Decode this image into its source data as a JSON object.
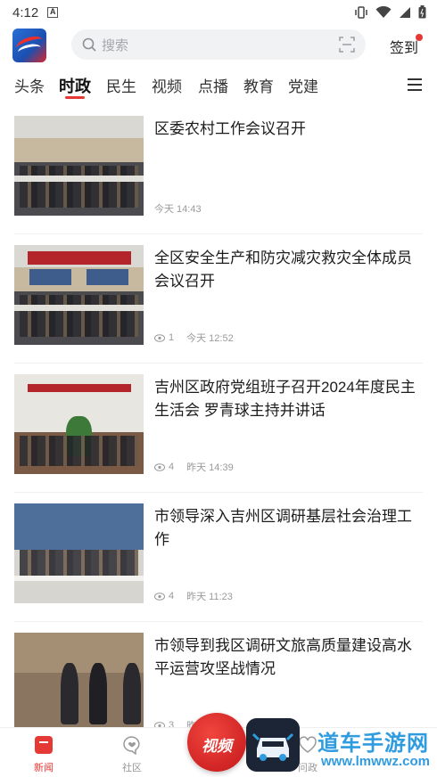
{
  "status_bar": {
    "time": "4:12",
    "notification_glyph": "A"
  },
  "header": {
    "search_placeholder": "搜索",
    "signin_label": "签到"
  },
  "tabs": [
    {
      "label": "头条",
      "active": false
    },
    {
      "label": "时政",
      "active": true
    },
    {
      "label": "民生",
      "active": false
    },
    {
      "label": "视频",
      "active": false
    },
    {
      "label": "点播",
      "active": false
    },
    {
      "label": "教育",
      "active": false
    },
    {
      "label": "党建",
      "active": false
    }
  ],
  "news": [
    {
      "title": "区委农村工作会议召开",
      "views": "",
      "time": "今天 14:43"
    },
    {
      "title": "全区安全生产和防灾减灾救灾全体成员会议召开",
      "views": "1",
      "time": "今天 12:52"
    },
    {
      "title": "吉州区政府党组班子召开2024年度民主生活会 罗青球主持并讲话",
      "views": "4",
      "time": "昨天 14:39"
    },
    {
      "title": "市领导深入吉州区调研基层社会治理工作",
      "views": "4",
      "time": "昨天 11:23"
    },
    {
      "title": "市领导到我区调研文旅高质量建设高水平运营攻坚战情况",
      "views": "3",
      "time": "昨"
    }
  ],
  "bottom_nav": [
    {
      "label": "新闻",
      "icon": "news-icon",
      "active": true
    },
    {
      "label": "社区",
      "icon": "community-icon",
      "active": false
    },
    {
      "label": "问政",
      "icon": "heart-icon",
      "active": false
    }
  ],
  "video_button": {
    "label": "视频"
  },
  "watermark": {
    "text": "道车手游网",
    "url": "www.lmwwz.com"
  },
  "colors": {
    "accent": "#e53935",
    "text": "#1c1c1c",
    "meta": "#9a9a9a",
    "watermark": "#2f9ce0"
  }
}
